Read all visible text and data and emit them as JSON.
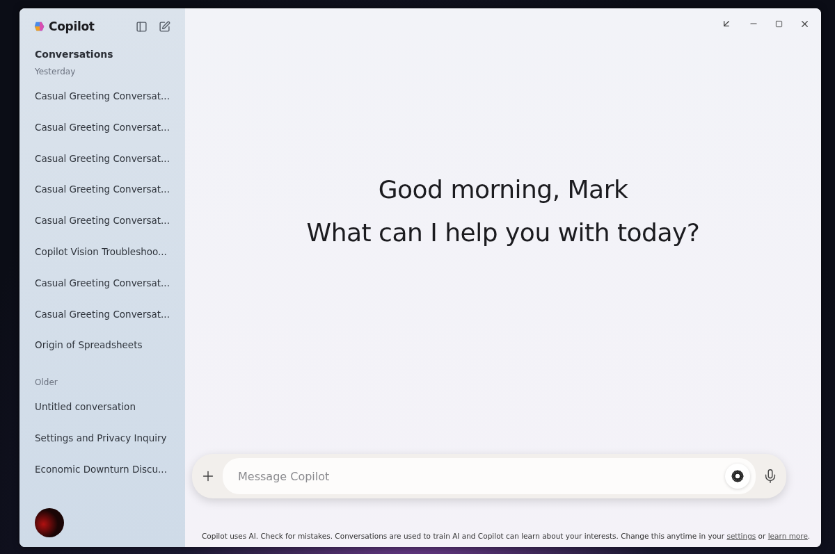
{
  "app": {
    "name": "Copilot"
  },
  "sidebar": {
    "heading": "Conversations",
    "groups": [
      {
        "label": "Yesterday",
        "items": [
          {
            "title": "Casual Greeting Conversat...",
            "selected": false
          },
          {
            "title": "Casual Greeting Conversat...",
            "selected": false
          },
          {
            "title": "Casual Greeting Conversat...",
            "selected": false
          },
          {
            "title": "Casual Greeting Conversat...",
            "selected": false
          },
          {
            "title": "Casual Greeting Conversat...",
            "selected": false
          },
          {
            "title": "Copilot Vision Troubleshoo...",
            "selected": false
          },
          {
            "title": "Casual Greeting Conversat...",
            "selected": false
          },
          {
            "title": "Casual Greeting Conversat...",
            "selected": false
          },
          {
            "title": "Origin of Spreadsheets",
            "selected": false
          }
        ]
      },
      {
        "label": "Older",
        "items": [
          {
            "title": "Untitled conversation",
            "selected": false
          },
          {
            "title": "Settings and Privacy Inquiry",
            "selected": false
          },
          {
            "title": "Economic Downturn Discu...",
            "selected": false
          }
        ]
      }
    ]
  },
  "greeting": {
    "line_1": "Good morning, Mark",
    "line_2": "What can I help you with today?"
  },
  "composer": {
    "placeholder": "Message Copilot"
  },
  "footer": [
    {
      "kind": "text",
      "text": "Copilot uses AI. Check for mistakes. Conversations are used to train AI and Copilot can learn about your interests. Change this anytime in your "
    },
    {
      "kind": "link",
      "text": "settings"
    },
    {
      "kind": "text",
      "text": " or "
    },
    {
      "kind": "link",
      "text": "learn more"
    },
    {
      "kind": "text",
      "text": "."
    }
  ]
}
